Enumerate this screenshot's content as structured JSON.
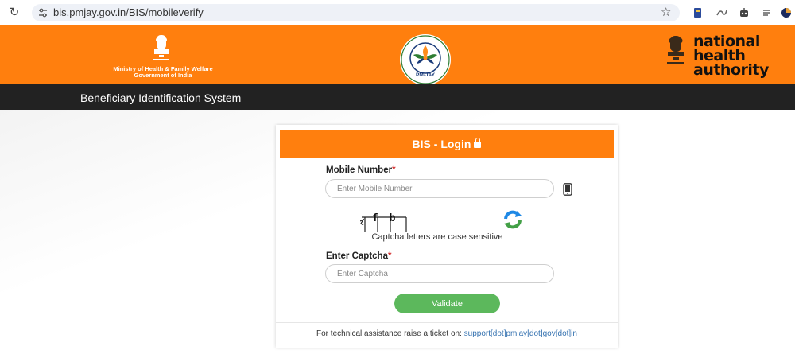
{
  "browser": {
    "url": "bis.pmjay.gov.in/BIS/mobileverify"
  },
  "header": {
    "ministry_line1": "Ministry of Health & Family Welfare",
    "ministry_line2": "Government of India",
    "center_logo_label": "PM-JAY",
    "nha_line1": "national",
    "nha_line2": "health",
    "nha_line3": "authority"
  },
  "title_bar": {
    "title": "Beneficiary Identification System"
  },
  "login": {
    "heading": "BIS - Login",
    "mobile_label": "Mobile Number",
    "mobile_placeholder": "Enter Mobile Number",
    "mobile_value": "",
    "required_mark": "*",
    "captcha_text": "f b",
    "captcha_note": "Captcha letters are case sensitive",
    "captcha_label": "Enter Captcha",
    "captcha_placeholder": "Enter Captcha",
    "captcha_value": "",
    "validate_label": "Validate",
    "assist_prefix": "For technical assistance raise a ticket on: ",
    "assist_link": "support[dot]pmjay[dot]gov[dot]in"
  },
  "colors": {
    "orange": "#ff7f0e",
    "dark_bar": "#222222",
    "validate_green": "#5cb85c",
    "link_blue": "#3572b0"
  }
}
